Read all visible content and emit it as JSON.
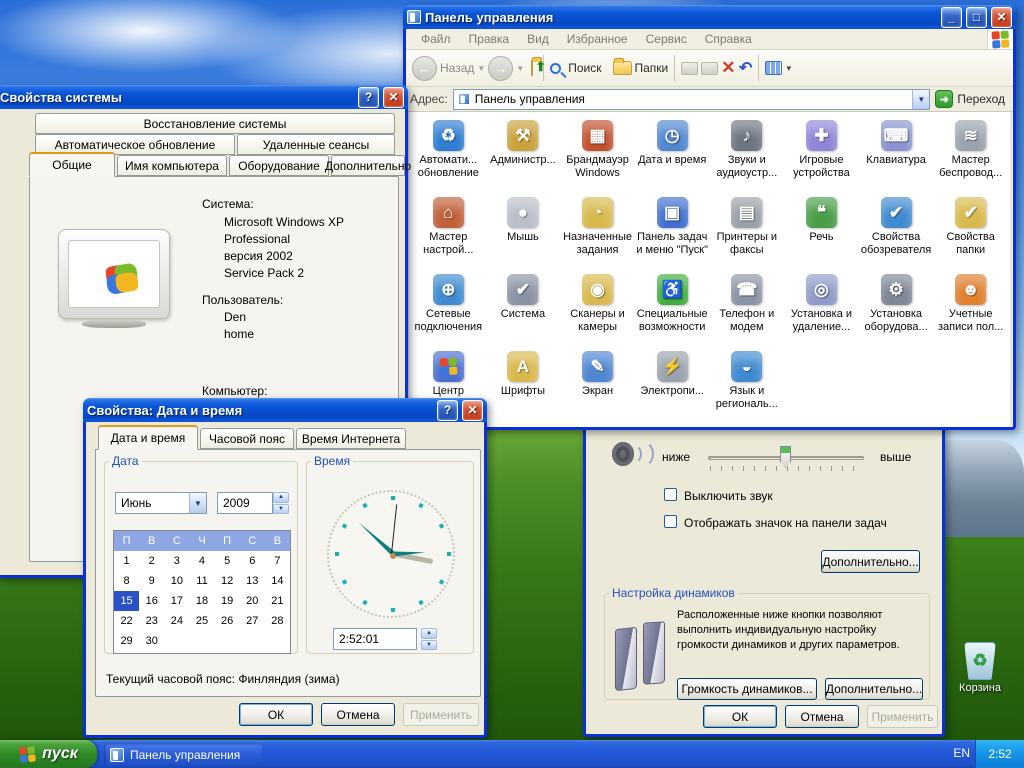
{
  "theme": {
    "titlebar_blue": "#0a55d5",
    "window_face": "#ece9d8",
    "selection_blue": "#2a50c8",
    "start_green": "#2f8b27",
    "clock_hand_teal": "#0b7f7f"
  },
  "desktop": {
    "recycle_bin_label": "Корзина"
  },
  "taskbar": {
    "start_label": "пуск",
    "tasks": [
      {
        "label": "Панель управления"
      }
    ],
    "language_indicator": "EN",
    "clock": "2:52"
  },
  "control_panel": {
    "title": "Панель управления",
    "menu": [
      "Файл",
      "Правка",
      "Вид",
      "Избранное",
      "Сервис",
      "Справка"
    ],
    "toolbar": {
      "back_label": "Назад",
      "search_label": "Поиск",
      "folders_label": "Папки"
    },
    "address_label": "Адрес:",
    "address_value": "Панель управления",
    "go_label": "Переход",
    "items": [
      {
        "icon": "automatic-updates",
        "glyph": "♻",
        "color": "#2e7dd1",
        "l1": "Автомати...",
        "l2": "обновление"
      },
      {
        "icon": "administration",
        "glyph": "⚒",
        "color": "#c9a23c",
        "l1": "Администр...",
        "l2": ""
      },
      {
        "icon": "windows-firewall",
        "glyph": "▦",
        "color": "#c1502e",
        "l1": "Брандмауэр",
        "l2": "Windows"
      },
      {
        "icon": "date-and-time",
        "glyph": "◷",
        "color": "#4f86d0",
        "l1": "Дата и время",
        "l2": ""
      },
      {
        "icon": "sounds-audio",
        "glyph": "♪",
        "color": "#6e7582",
        "l1": "Звуки и",
        "l2": "аудиоустр..."
      },
      {
        "icon": "game-controllers",
        "glyph": "✚",
        "color": "#8f86d8",
        "l1": "Игровые",
        "l2": "устройства"
      },
      {
        "icon": "keyboard",
        "glyph": "⌨",
        "color": "#8a93cf",
        "l1": "Клавиатура",
        "l2": ""
      },
      {
        "icon": "wireless-wizard",
        "glyph": "≋",
        "color": "#9aa3ad",
        "l1": "Мастер",
        "l2": "беспровод..."
      },
      {
        "icon": "network-setup-wizard",
        "glyph": "⌂",
        "color": "#c0603a",
        "l1": "Мастер",
        "l2": "настрой..."
      },
      {
        "icon": "mouse",
        "glyph": "●",
        "color": "#b9bfca",
        "l1": "Мышь",
        "l2": ""
      },
      {
        "icon": "scheduled-tasks",
        "glyph": "◔",
        "color": "#d9b94e",
        "l1": "Назначенные",
        "l2": "задания"
      },
      {
        "icon": "taskbar-start-menu",
        "glyph": "▣",
        "color": "#3f6fd0",
        "l1": "Панель задач",
        "l2": "и меню \"Пуск\""
      },
      {
        "icon": "printers-faxes",
        "glyph": "▤",
        "color": "#9aa0a8",
        "l1": "Принтеры и",
        "l2": "факсы"
      },
      {
        "icon": "speech",
        "glyph": "❝",
        "color": "#4a9e4a",
        "l1": "Речь",
        "l2": ""
      },
      {
        "icon": "internet-options",
        "glyph": "✔",
        "color": "#3f8ad0",
        "l1": "Свойства",
        "l2": "обозревателя"
      },
      {
        "icon": "folder-options",
        "glyph": "✔",
        "color": "#d9b94e",
        "l1": "Свойства",
        "l2": "папки"
      },
      {
        "icon": "network-connections",
        "glyph": "⊕",
        "color": "#3f8ad0",
        "l1": "Сетевые",
        "l2": "подключения"
      },
      {
        "icon": "system",
        "glyph": "✔",
        "color": "#8a93a5",
        "l1": "Система",
        "l2": ""
      },
      {
        "icon": "scanners-cameras",
        "glyph": "◉",
        "color": "#d9b94e",
        "l1": "Сканеры и",
        "l2": "камеры"
      },
      {
        "icon": "accessibility",
        "glyph": "♿",
        "color": "#3fae3f",
        "l1": "Специальные",
        "l2": "возможности"
      },
      {
        "icon": "phone-modem",
        "glyph": "☎",
        "color": "#8a93a5",
        "l1": "Телефон и",
        "l2": "модем"
      },
      {
        "icon": "add-remove-programs",
        "glyph": "◎",
        "color": "#8f9bc9",
        "l1": "Установка и",
        "l2": "удаление..."
      },
      {
        "icon": "add-hardware",
        "glyph": "⚙",
        "color": "#7f8795",
        "l1": "Установка",
        "l2": "оборудова..."
      },
      {
        "icon": "user-accounts",
        "glyph": "☻",
        "color": "#e08030",
        "l1": "Учетные",
        "l2": "записи пол..."
      },
      {
        "icon": "security-center",
        "glyph": "",
        "color": "#4a6fd0",
        "flag": true,
        "l1": "Центр",
        "l2": ""
      },
      {
        "icon": "fonts",
        "glyph": "А",
        "color": "#d9b94e",
        "l1": "Шрифты",
        "l2": ""
      },
      {
        "icon": "display",
        "glyph": "✎",
        "color": "#4f86d0",
        "l1": "Экран",
        "l2": ""
      },
      {
        "icon": "power-options",
        "glyph": "⚡",
        "color": "#9aa3ad",
        "l1": "Электропи...",
        "l2": ""
      },
      {
        "icon": "regional-language",
        "glyph": "◒",
        "color": "#3f8ad0",
        "l1": "Язык и",
        "l2": "региональ..."
      }
    ]
  },
  "system_properties": {
    "title": "Свойства системы",
    "tabs_row1": [
      "Восстановление системы"
    ],
    "tabs_row2": [
      "Автоматическое обновление",
      "Удаленные сеансы"
    ],
    "tabs_row3": [
      "Общие",
      "Имя компьютера",
      "Оборудование",
      "Дополнительно"
    ],
    "active_tab": "Общие",
    "system_label": "Система:",
    "system_lines": [
      "Microsoft Windows XP",
      "Professional",
      "версия 2002",
      "Service Pack 2"
    ],
    "user_label": "Пользователь:",
    "user_lines": [
      "Den",
      "home"
    ],
    "computer_label": "Компьютер:"
  },
  "datetime_dialog": {
    "title": "Свойства: Дата и время",
    "tabs": [
      "Дата и время",
      "Часовой пояс",
      "Время Интернета"
    ],
    "active_tab": "Дата и время",
    "date_group_label": "Дата",
    "month_value": "Июнь",
    "year_value": "2009",
    "weekdays": [
      "П",
      "В",
      "С",
      "Ч",
      "П",
      "С",
      "В"
    ],
    "days": [
      1,
      2,
      3,
      4,
      5,
      6,
      7,
      8,
      9,
      10,
      11,
      12,
      13,
      14,
      15,
      16,
      17,
      18,
      19,
      20,
      21,
      22,
      23,
      24,
      25,
      26,
      27,
      28,
      29,
      30
    ],
    "selected_day": 15,
    "time_group_label": "Время",
    "time_value": "2:52:01",
    "timezone_note": "Текущий часовой пояс: Финляндия (зима)",
    "ok_label": "ОК",
    "cancel_label": "Отмена",
    "apply_label": "Применить"
  },
  "sound_dialog": {
    "low_label": "ниже",
    "high_label": "выше",
    "mute_checkbox_label": "Выключить звук",
    "tray_checkbox_label": "Отображать значок на панели задач",
    "advanced_button": "Дополнительно...",
    "speakers_group_label": "Настройка динамиков",
    "speakers_text": "Расположенные ниже кнопки позволяют выполнить индивидуальную настройку громкости динамиков и других параметров.",
    "speaker_volume_button": "Громкость динамиков...",
    "speakers_advanced_button": "Дополнительно...",
    "ok_label": "ОК",
    "cancel_label": "Отмена",
    "apply_label": "Применить"
  }
}
